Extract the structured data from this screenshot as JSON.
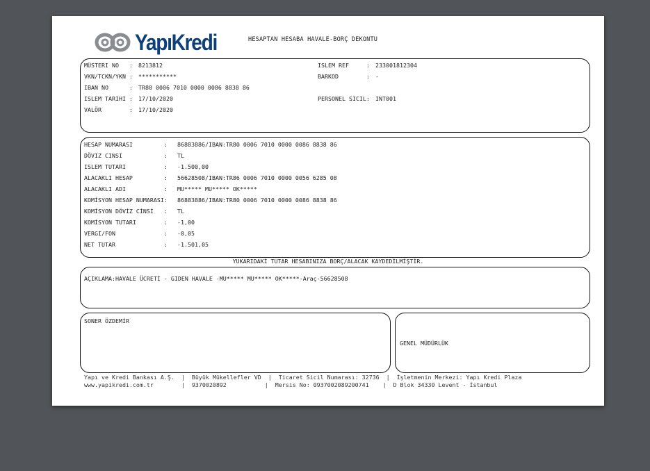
{
  "header": {
    "logo_text": "YapıKredi",
    "doc_title": "HESAPTAN HESABA HAVALE-BORÇ DEKONTU"
  },
  "customer": {
    "musteri_no_label": "MÜSTERI NO   :",
    "musteri_no": "8213812",
    "vkn_label": "VKN/TCKN/YKN :",
    "vkn": "***********",
    "iban_label": "IBAN NO      :",
    "iban": "TR80 0006 7010 0000 0086 8838 86",
    "islem_tarihi_label": "ISLEM TARIHI :",
    "islem_tarihi": "17/10/2020",
    "valor_label": "VALÖR        :",
    "valor": "17/10/2020",
    "islem_ref_label": "ISLEM REF     :",
    "islem_ref": "233001812304",
    "barkod_label": "BARKOD        :",
    "barkod": "-",
    "personel_sicil_label": "PERSONEL SICIL:",
    "personel_sicil": "INT001"
  },
  "transaction": {
    "rows": [
      {
        "label": "HESAP NUMARASI         :",
        "value": "86883886/IBAN:TR80 0006 7010 0000 0086 8838 86"
      },
      {
        "label": "DÖVIZ CINSI            :",
        "value": "TL"
      },
      {
        "label": "ISLEM TUTARI           :",
        "value": "-1.500,00"
      },
      {
        "label": "ALACAKLI HESAP         :",
        "value": "56628508/IBAN:TR86 0006 7010 0000 0056 6285 08"
      },
      {
        "label": "ALACAKLI ADI           :",
        "value": "MU***** MU***** OK*****"
      },
      {
        "label": "KOMİSYON HESAP NUMARASI:",
        "value": "86883886/IBAN:TR80 0006 7010 0000 0086 8838 86"
      },
      {
        "label": "KOMİSYON DÖVİZ CİNSİ   :",
        "value": "TL"
      },
      {
        "label": "KOMİSYON TUTARI        :",
        "value": "-1,00"
      },
      {
        "label": "VERGI/FON              :",
        "value": "-0,05"
      },
      {
        "label": "NET TUTAR              :",
        "value": "-1.501,05"
      }
    ]
  },
  "notice": "YUKARIDAKİ TUTAR HESABINIZA BORÇ/ALACAK KAYDEDİLMİŞTİR.",
  "description": "AÇIKLAMA:HAVALE ÜCRETİ - GIDEN HAVALE -MU***** MU***** OK*****-Araç-56628508",
  "signatures": {
    "left": "SONER ÖZDEMİR",
    "right": "GENEL MÜDÜRLÜK"
  },
  "footer": {
    "line1": "Yapı ve Kredi Bankası A.Ş.  |  Büyük Mükellefler VD  |  Ticaret Sicil Numarası: 32736  |  İşletmenin Merkezi: Yapı Kredi Plaza",
    "line2": "www.yapikredi.com.tr        |  9370020892           |  Mersis No: 0937002089200741    |  D Blok 34330 Levent - İstanbul"
  },
  "colors": {
    "page_bg": "#515559",
    "logo_blue": "#0d3f7a",
    "logo_grey": "#8a8d90"
  }
}
